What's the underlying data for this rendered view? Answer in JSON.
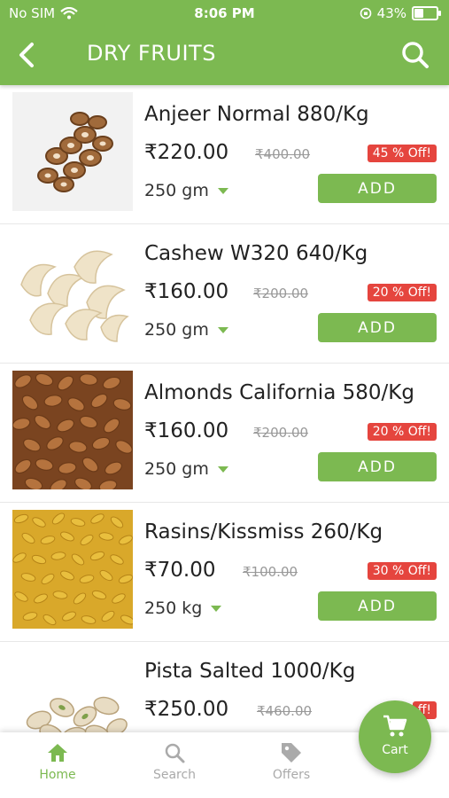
{
  "status_bar": {
    "carrier": "No SIM",
    "time": "8:06 PM",
    "battery": "43%"
  },
  "header": {
    "title": "DRY FRUITS"
  },
  "products": [
    {
      "name": "Anjeer Normal 880/Kg",
      "price": "₹220.00",
      "mrp": "₹400.00",
      "discount": "45 % Off!",
      "qty": "250 gm",
      "add_label": "ADD"
    },
    {
      "name": "Cashew W320 640/Kg",
      "price": "₹160.00",
      "mrp": "₹200.00",
      "discount": "20 % Off!",
      "qty": "250 gm",
      "add_label": "ADD"
    },
    {
      "name": "Almonds California 580/Kg",
      "price": "₹160.00",
      "mrp": "₹200.00",
      "discount": "20 % Off!",
      "qty": "250 gm",
      "add_label": "ADD"
    },
    {
      "name": "Rasins/Kissmiss 260/Kg",
      "price": "₹70.00",
      "mrp": "₹100.00",
      "discount": "30 % Off!",
      "qty": "250 kg",
      "add_label": "ADD"
    },
    {
      "name": "Pista Salted 1000/Kg",
      "price": "₹250.00",
      "mrp": "₹460.00",
      "discount": "ff!",
      "qty": "",
      "add_label": ""
    }
  ],
  "bottom_nav": {
    "home": "Home",
    "search": "Search",
    "offers": "Offers",
    "cart": "Cart"
  },
  "colors": {
    "primary": "#7cb951",
    "discount": "#e5453e"
  }
}
